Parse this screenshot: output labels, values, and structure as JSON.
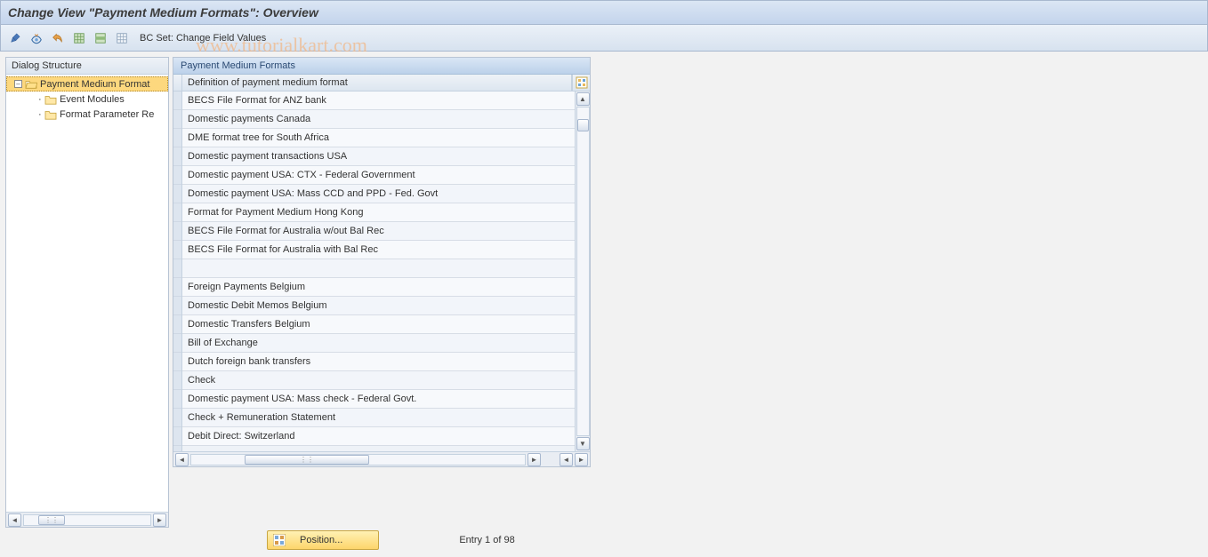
{
  "title": "Change View \"Payment Medium Formats\": Overview",
  "toolbar": {
    "bcset_label": "BC Set: Change Field Values"
  },
  "watermark": "www.tutorialkart.com",
  "tree": {
    "header": "Dialog Structure",
    "root": "Payment Medium Format",
    "children": [
      "Event Modules",
      "Format Parameter Re"
    ]
  },
  "table": {
    "title": "Payment Medium Formats",
    "column_header": "Definition of payment medium format",
    "rows": [
      "BECS File Format for ANZ bank",
      "Domestic payments Canada",
      "DME format tree for South Africa",
      "Domestic payment transactions USA",
      "Domestic payment USA: CTX - Federal Government",
      "Domestic payment USA: Mass CCD and PPD - Fed. Govt",
      "Format for Payment Medium Hong Kong",
      "BECS File Format for Australia w/out Bal Rec",
      "BECS File Format for Australia with Bal Rec",
      "",
      "Foreign Payments Belgium",
      "Domestic Debit Memos Belgium",
      "Domestic Transfers Belgium",
      "Bill of Exchange",
      "Dutch foreign bank transfers",
      "Check",
      "Domestic payment USA: Mass check - Federal Govt.",
      "Check + Remuneration Statement",
      "Debit Direct: Switzerland"
    ]
  },
  "footer": {
    "position_label": "Position...",
    "entry_text": "Entry 1 of 98"
  }
}
